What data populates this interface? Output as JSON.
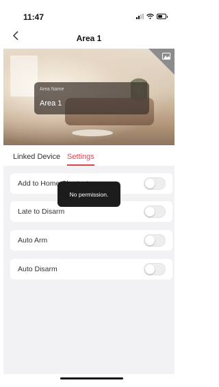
{
  "status_bar": {
    "time": "11:47"
  },
  "nav": {
    "back_icon": "chevron-left-icon",
    "title": "Area 1"
  },
  "hero": {
    "image_icon": "image-icon",
    "name_label": "Area Name",
    "name_value": "Area 1"
  },
  "tabs": [
    {
      "label": "Linked Device",
      "active": false
    },
    {
      "label": "Settings",
      "active": true
    }
  ],
  "settings": [
    {
      "label": "Add to Home Shortcut",
      "enabled": false
    },
    {
      "label": "Late to Disarm",
      "enabled": false
    },
    {
      "label": "Auto Arm",
      "enabled": false
    },
    {
      "label": "Auto Disarm",
      "enabled": false
    }
  ],
  "toast": {
    "message": "No permission."
  },
  "colors": {
    "accent": "#e0424d",
    "background": "#f2f2f4",
    "toast": "#1c1c1c"
  }
}
